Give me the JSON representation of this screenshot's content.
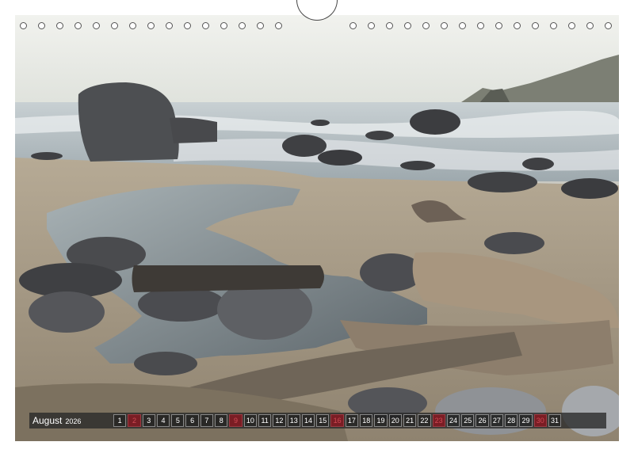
{
  "calendar": {
    "month": "August",
    "year": "2026",
    "days": [
      {
        "d": "1",
        "sunday": false
      },
      {
        "d": "2",
        "sunday": true
      },
      {
        "d": "3",
        "sunday": false
      },
      {
        "d": "4",
        "sunday": false
      },
      {
        "d": "5",
        "sunday": false
      },
      {
        "d": "6",
        "sunday": false
      },
      {
        "d": "7",
        "sunday": false
      },
      {
        "d": "8",
        "sunday": false
      },
      {
        "d": "9",
        "sunday": true
      },
      {
        "d": "10",
        "sunday": false
      },
      {
        "d": "11",
        "sunday": false
      },
      {
        "d": "12",
        "sunday": false
      },
      {
        "d": "13",
        "sunday": false
      },
      {
        "d": "14",
        "sunday": false
      },
      {
        "d": "15",
        "sunday": false
      },
      {
        "d": "16",
        "sunday": true
      },
      {
        "d": "17",
        "sunday": false
      },
      {
        "d": "18",
        "sunday": false
      },
      {
        "d": "19",
        "sunday": false
      },
      {
        "d": "20",
        "sunday": false
      },
      {
        "d": "21",
        "sunday": false
      },
      {
        "d": "22",
        "sunday": false
      },
      {
        "d": "23",
        "sunday": true
      },
      {
        "d": "24",
        "sunday": false
      },
      {
        "d": "25",
        "sunday": false
      },
      {
        "d": "26",
        "sunday": false
      },
      {
        "d": "27",
        "sunday": false
      },
      {
        "d": "28",
        "sunday": false
      },
      {
        "d": "29",
        "sunday": false
      },
      {
        "d": "30",
        "sunday": true
      },
      {
        "d": "31",
        "sunday": false
      }
    ]
  },
  "binding": {
    "ring_count_left": 15,
    "ring_count_right": 15
  },
  "colors": {
    "sky": "#e9ebe6",
    "sea": "#b7c2c8",
    "sand": "#a69a86",
    "rock": "#45464a",
    "driftwood": "#9b8c7a",
    "sunday": "#7a1d24"
  }
}
